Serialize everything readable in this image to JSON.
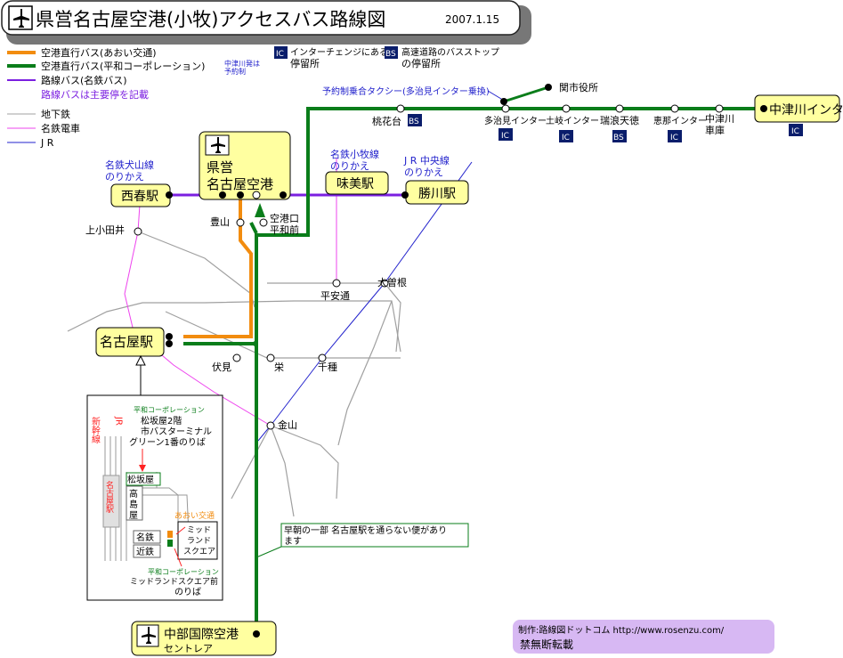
{
  "title": {
    "text": "県営名古屋空港(小牧)アクセスバス路線図",
    "date": "2007.1.15"
  },
  "legend": {
    "aoi": "空港直行バス(あおい交通)",
    "heiwa": "空港直行バス(平和コーポレーション)",
    "heiwa_note1": "中津川発は",
    "heiwa_note2": "予約制",
    "meitetsu_bus": "路線バス(名鉄バス)",
    "main_stops": "路線バスは主要停を記載",
    "subway": "地下鉄",
    "meitetsu_train": "名鉄電車",
    "jr": "J R",
    "ic_badge": "IC",
    "ic_text1": "インターチェンジにある",
    "ic_text2": "停留所",
    "bs_badge": "BS",
    "bs_text1": "高速道路のバスストップ",
    "bs_text2": "の停留所"
  },
  "stations": {
    "airport1": "県営",
    "airport2": "名古屋空港",
    "nishiharu": "西春駅",
    "ajima": "味美駅",
    "kachigawa": "勝川駅",
    "nagoya": "名古屋駅",
    "centrair1": "中部国際空港",
    "centrair2": "セントレア",
    "nakatsugawa": "中津川インター"
  },
  "transfers": {
    "inuyama1": "名鉄犬山線",
    "inuyama2": "のりかえ",
    "komaki1": "名鉄小牧線",
    "komaki2": "のりかえ",
    "chuo1": "J R 中央線",
    "chuo2": "のりかえ"
  },
  "stops": {
    "kamiotai": "上小田井",
    "toyoyama": "豊山",
    "kukoguchi1": "空港口",
    "kukoguchi2": "平和前",
    "heianDori": "平安通",
    "ozone": "大曽根",
    "fushimi": "伏見",
    "sakae": "栄",
    "chikusa": "千種",
    "kanayama": "金山",
    "tokadai": "桃花台",
    "tajimi": "多治見インター",
    "toki": "土岐インター",
    "mizunami": "瑞浪天徳",
    "ena": "恵那インター",
    "nakatsugawa_garage1": "中津川",
    "nakatsugawa_garage2": "車庫",
    "cityhall": "関市役所"
  },
  "notes": {
    "taxi": "予約制乗合タクシー(多治見インター乗換)",
    "early1": "早朝の一部 名古屋駅を通らない便があり",
    "early2": "ます"
  },
  "inset": {
    "shinkansen": "新幹線",
    "jr": "JR",
    "heiwa_label": "平和コーポレーション",
    "heiwa_info1": "松坂屋2階",
    "heiwa_info2": "市バスターミナル",
    "heiwa_info3": "グリーン1番のりば",
    "matsuzakaya": "松坂屋",
    "takashimaya1": "高",
    "takashimaya2": "島",
    "takashimaya3": "屋",
    "nagoya_station": "名古屋駅",
    "meitetsu": "名鉄",
    "kintetsu": "近鉄",
    "aoi_label": "あおい交通",
    "midland1": "ミッド",
    "midland2": "ランド",
    "midland3": "スクエア",
    "heiwa_label2": "平和コーポレーション",
    "heiwa_stop1": "ミッドランドスクエア前",
    "heiwa_stop2": "のりば"
  },
  "credit": {
    "line1": "制作:路線図ドットコム http://www.rosenzu.com/",
    "line2": "禁無断転載"
  },
  "colors": {
    "aoi": "#f28c0f",
    "heiwa": "#0a7d1a",
    "meitetsu_bus": "#7b1fe0",
    "subway": "#a0a0a0",
    "meitetsu_train": "#ee44ee",
    "jr": "#2222cc",
    "station_fill": "#ffffa0",
    "badge": "#0a1d6b",
    "credit_bg": "#d7b8f3"
  }
}
